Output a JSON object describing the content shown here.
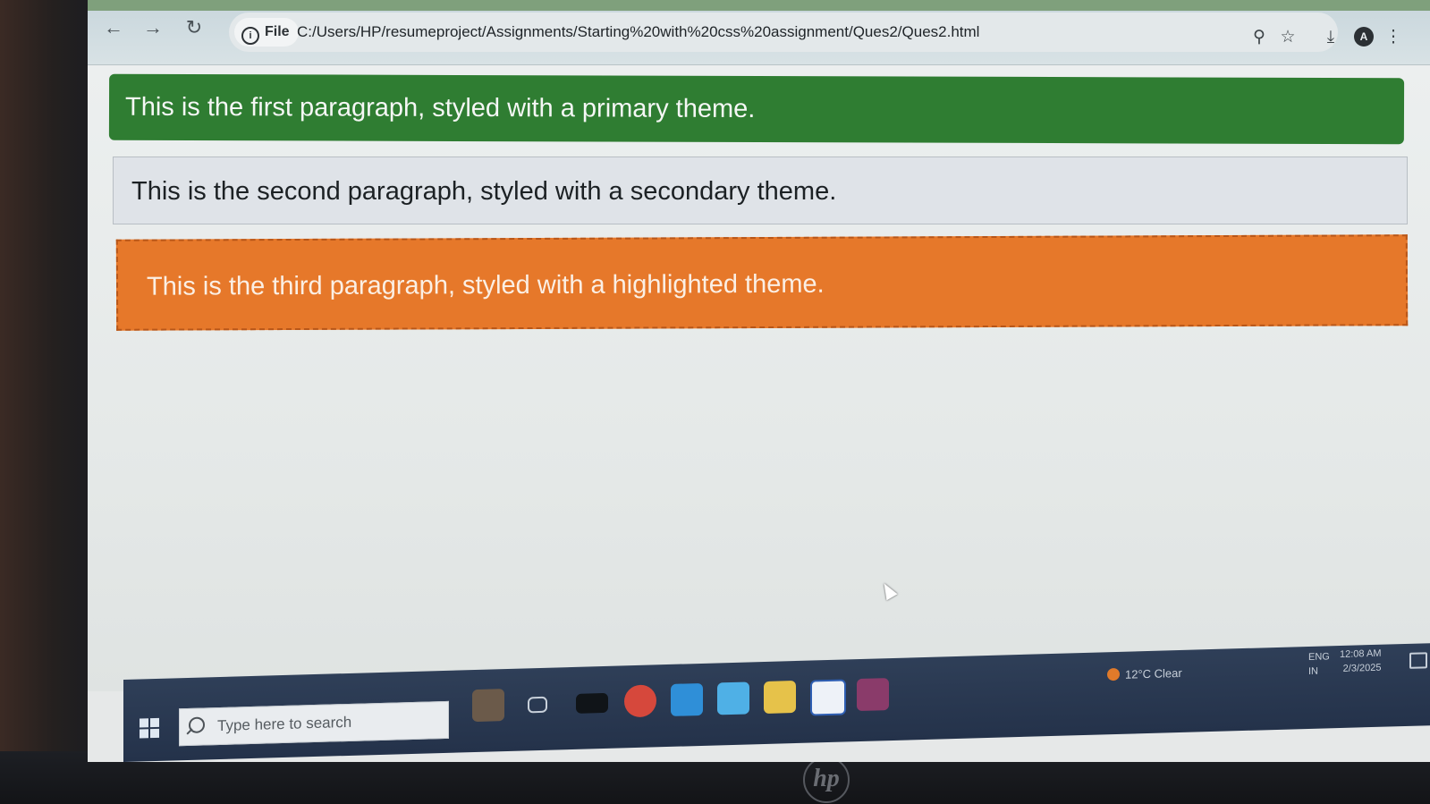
{
  "browser": {
    "url_chip": "File",
    "url": "C:/Users/HP/resumeproject/Assignments/Starting%20with%20css%20assignment/Ques2/Ques2.html",
    "profile_initial": "A",
    "icons": [
      "back-icon",
      "forward-icon",
      "reload-icon",
      "info-icon",
      "zoom-icon",
      "star-icon",
      "download-icon",
      "menu-icon"
    ]
  },
  "page": {
    "paragraphs": [
      {
        "text": "This is the first paragraph, styled with a primary theme.",
        "theme": "primary",
        "color": "#2f7d32"
      },
      {
        "text": "This is the second paragraph, styled with a secondary theme.",
        "theme": "secondary",
        "color": "#dfe3e8"
      },
      {
        "text": "This is the third paragraph, styled with a highlighted theme.",
        "theme": "highlighted",
        "color": "#e6782a"
      }
    ]
  },
  "taskbar": {
    "search_placeholder": "Type here to search",
    "apps": [
      "widgets-icon",
      "task-view-icon",
      "terminal-icon",
      "chrome-icon",
      "vscode-icon",
      "photos-icon",
      "file-explorer-icon",
      "word-icon",
      "winrar-icon"
    ],
    "weather": "12°C  Clear",
    "lang_line1": "ENG",
    "lang_line2": "IN",
    "time": "12:08 AM",
    "date": "2/3/2025"
  },
  "device": {
    "brand": "hp"
  }
}
